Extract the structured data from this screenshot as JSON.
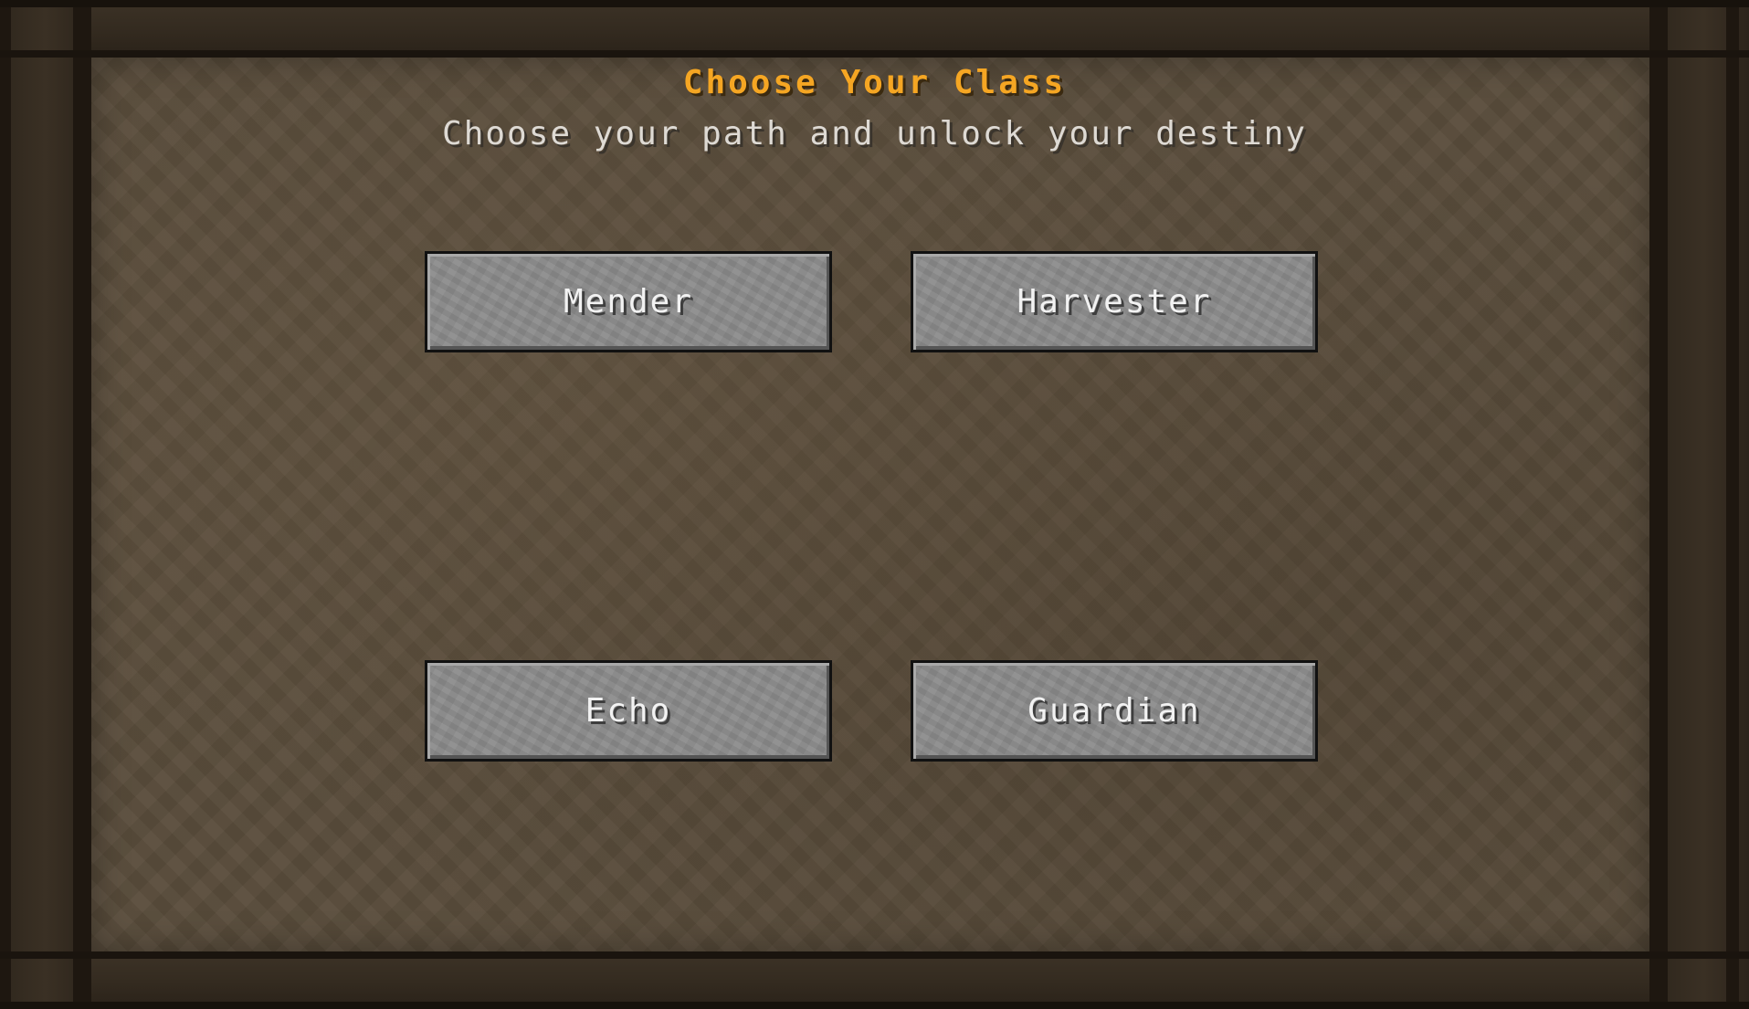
{
  "screen": {
    "title": "Choose Your Class",
    "subtitle": "Choose your path and unlock your destiny"
  },
  "classes": [
    {
      "label": "Mender"
    },
    {
      "label": "Harvester"
    },
    {
      "label": "Echo"
    },
    {
      "label": "Guardian"
    }
  ],
  "colors": {
    "title": "#f5a623",
    "subtitle": "#dedad4",
    "button_face": "#8a8a8a",
    "panel": "#5a4d3c",
    "frame": "#2e261d"
  }
}
